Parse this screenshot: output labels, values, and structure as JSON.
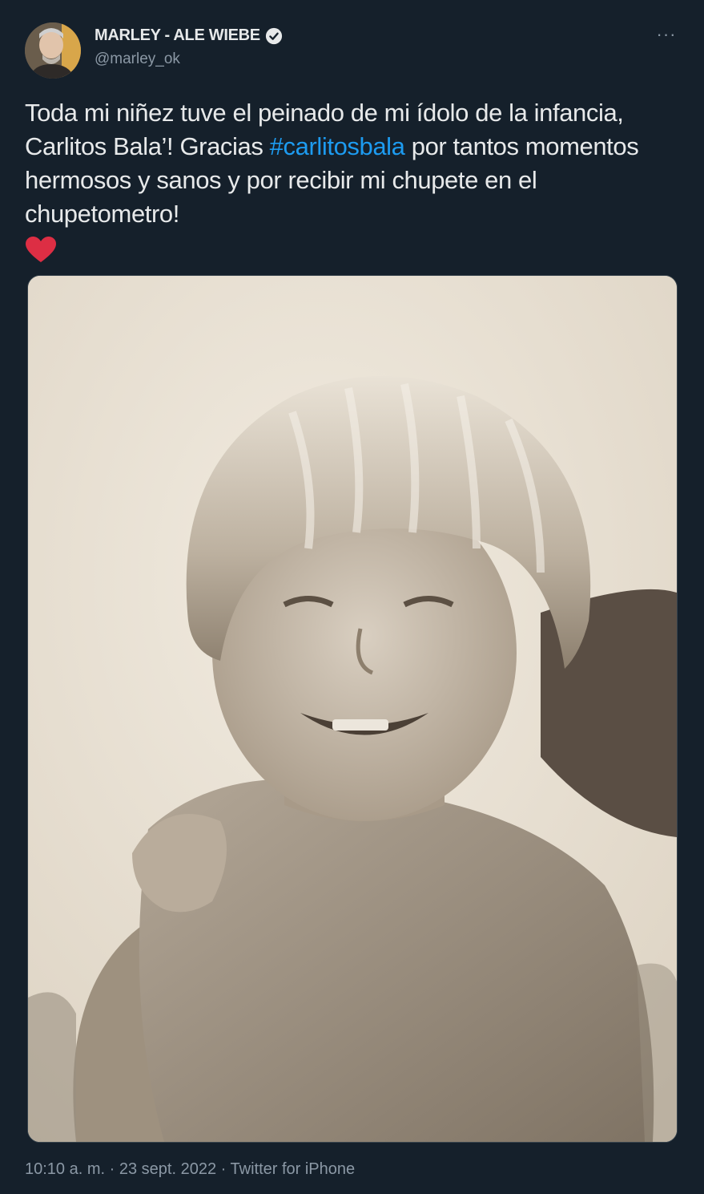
{
  "tweet": {
    "author": {
      "display_name": "MARLEY - ALE WIEBE",
      "handle": "@marley_ok",
      "verified_icon": "verified-badge-icon"
    },
    "more_label": "···",
    "text_parts": {
      "before_hashtag": "Toda mi niñez tuve el peinado de mi ídolo de la infancia, Carlitos Bala’! Gracias ",
      "hashtag": "#carlitosbala",
      "after_hashtag": " por tantos momentos hermosos y sanos y por recibir mi chupete en el chupetometro!"
    },
    "emoji": "heart-emoji",
    "timestamp": "10:10 a. m.",
    "separator": "·",
    "date": "23 sept. 2022",
    "source": "Twitter for iPhone"
  },
  "colors": {
    "background": "#15202b",
    "text": "#e7e9ea",
    "secondary": "#8b98a5",
    "link": "#1d9bf0",
    "heart": "#f91880"
  }
}
